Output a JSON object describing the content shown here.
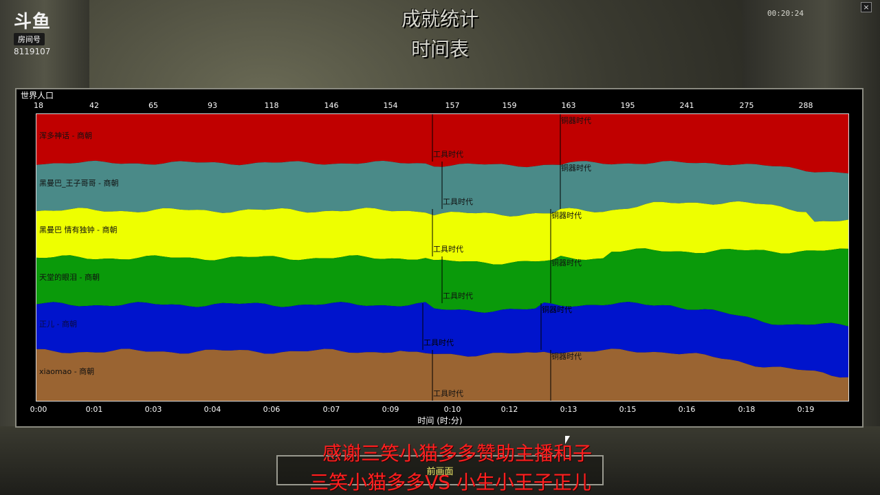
{
  "logo": {
    "mark": "斗鱼",
    "badge": "房间号",
    "room_id": "8119107"
  },
  "header": {
    "title": "成就统计",
    "subtitle": "时间表",
    "clock": "00:20:24",
    "close_label": "×"
  },
  "chart": {
    "metric_label": "世界人口",
    "x_title": "时间 (时:分)",
    "age_tool": "工具时代",
    "age_bronze": "铜器时代"
  },
  "chart_data": {
    "type": "area",
    "title": "世界人口",
    "xlabel": "时间 (时:分)",
    "x": [
      "0:00",
      "0:01",
      "0:03",
      "0:04",
      "0:06",
      "0:07",
      "0:09",
      "0:10",
      "0:12",
      "0:13",
      "0:15",
      "0:16",
      "0:18",
      "0:19"
    ],
    "population_ticks": [
      18,
      42,
      65,
      93,
      118,
      146,
      154,
      157,
      159,
      163,
      195,
      241,
      275,
      288
    ],
    "series": [
      {
        "name": "浑多神话 - 商朝",
        "color": "#c00000",
        "tool_age": "0:10",
        "bronze_age": "0:13"
      },
      {
        "name": "黑曼巴_王子哥哥 - 商朝",
        "color": "#4a8a88",
        "tool_age": "0:10",
        "bronze_age": "0:13"
      },
      {
        "name": "黑曼巴 情有独钟 - 商朝",
        "color": "#eeff00",
        "tool_age": "0:10",
        "bronze_age": "0:12"
      },
      {
        "name": "天堂的眼泪 - 商朝",
        "color": "#0a9a0a",
        "tool_age": "0:10",
        "bronze_age": "0:12"
      },
      {
        "name": "正儿 - 商朝",
        "color": "#0014cc",
        "tool_age": "0:09",
        "bronze_age": "0:12"
      },
      {
        "name": "xiaomao - 商朝",
        "color": "#9a6432",
        "tool_age": "0:10",
        "bronze_age": "0:12"
      }
    ]
  },
  "footer": {
    "prev_screen": "前画面",
    "overlay_thanks": "感谢三笑小猫多多赞助主播和子",
    "overlay_match": "三笑小猫多多VS 小生小王子正儿"
  }
}
